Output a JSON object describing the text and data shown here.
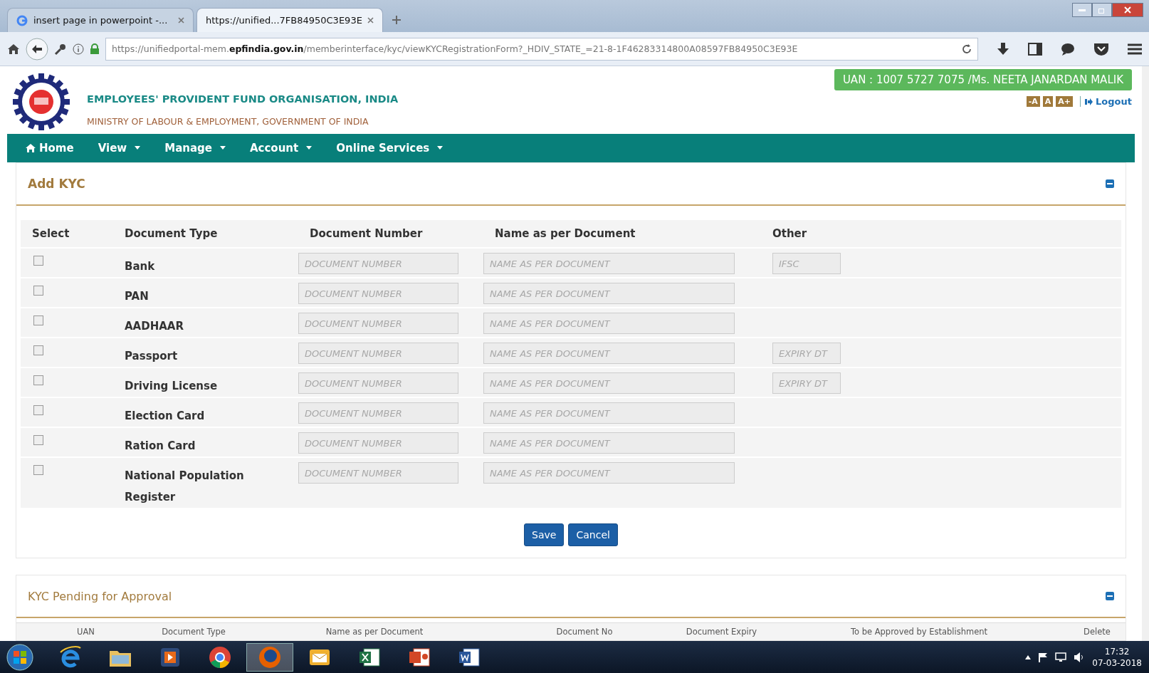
{
  "browser": {
    "tabs": [
      {
        "title": "insert page in powerpoint -...",
        "selected": false
      },
      {
        "title": "https://unified...7FB84950C3E93E",
        "selected": true
      }
    ],
    "url_prefix": "https://unifiedportal-mem.",
    "url_domain": "epfindia.gov.in",
    "url_rest": "/memberinterface/kyc/viewKYCRegistrationForm?_HDIV_STATE_=21-8-1F46283314800A08597FB84950C3E93E"
  },
  "header": {
    "title": "EMPLOYEES' PROVIDENT FUND ORGANISATION, INDIA",
    "subtitle": "MINISTRY OF LABOUR & EMPLOYMENT, GOVERNMENT OF INDIA",
    "user_badge": "UAN : 1007 5727 7075 /Ms. NEETA JANARDAN MALIK",
    "font_sizes": [
      "-A",
      "A",
      "A+"
    ],
    "logout": "Logout"
  },
  "menu": [
    {
      "label": "Home",
      "kind": "home"
    },
    {
      "label": "View",
      "kind": "dropdown"
    },
    {
      "label": "Manage",
      "kind": "dropdown"
    },
    {
      "label": "Account",
      "kind": "dropdown"
    },
    {
      "label": "Online Services",
      "kind": "dropdown"
    }
  ],
  "add_kyc": {
    "title": "Add KYC",
    "columns": [
      "Select",
      "Document Type",
      "Document Number",
      "Name as per Document",
      "Other"
    ],
    "rows": [
      {
        "checked": false,
        "type": "Bank",
        "number_placeholder": "DOCUMENT NUMBER",
        "name_placeholder": "NAME AS PER DOCUMENT",
        "other_placeholder": "IFSC"
      },
      {
        "checked": false,
        "type": "PAN",
        "number_placeholder": "DOCUMENT NUMBER",
        "name_placeholder": "NAME AS PER DOCUMENT"
      },
      {
        "checked": false,
        "type": "AADHAAR",
        "number_placeholder": "DOCUMENT NUMBER",
        "name_placeholder": "NAME AS PER DOCUMENT"
      },
      {
        "checked": false,
        "type": "Passport",
        "number_placeholder": "DOCUMENT NUMBER",
        "name_placeholder": "NAME AS PER DOCUMENT",
        "other_placeholder": "EXPIRY DT"
      },
      {
        "checked": false,
        "type": "Driving License",
        "number_placeholder": "DOCUMENT NUMBER",
        "name_placeholder": "NAME AS PER DOCUMENT",
        "other_placeholder": "EXPIRY DT"
      },
      {
        "checked": false,
        "type": "Election Card",
        "number_placeholder": "DOCUMENT NUMBER",
        "name_placeholder": "NAME AS PER DOCUMENT"
      },
      {
        "checked": false,
        "type": "Ration Card",
        "number_placeholder": "DOCUMENT NUMBER",
        "name_placeholder": "NAME AS PER DOCUMENT"
      },
      {
        "checked": false,
        "type": "National Population Register",
        "number_placeholder": "DOCUMENT NUMBER",
        "name_placeholder": "NAME AS PER DOCUMENT"
      }
    ],
    "buttons": [
      "Save",
      "Cancel"
    ]
  },
  "pending": {
    "title": "KYC Pending for Approval",
    "columns": [
      "UAN",
      "Document Type",
      "Name as per Document",
      "Document No",
      "Document Expiry",
      "To be Approved by Establishment",
      "Delete"
    ]
  },
  "taskbar": {
    "apps": [
      {
        "kind": "ie",
        "selected": false
      },
      {
        "kind": "folder",
        "selected": false
      },
      {
        "kind": "media",
        "selected": false
      },
      {
        "kind": "chrome",
        "selected": false
      },
      {
        "kind": "firefox",
        "selected": true
      },
      {
        "kind": "outlook",
        "selected": false
      },
      {
        "kind": "excel",
        "selected": false
      },
      {
        "kind": "powerpoint",
        "selected": false
      },
      {
        "kind": "word",
        "selected": false
      }
    ],
    "time": "17:32",
    "date": "07-03-2018"
  }
}
